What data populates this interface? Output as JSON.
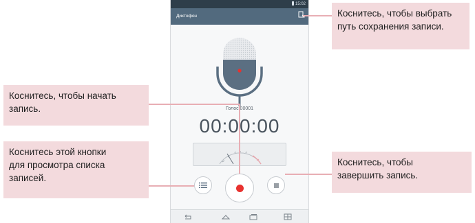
{
  "status_bar": {
    "time": "15:02"
  },
  "action_bar": {
    "title": "Диктофон"
  },
  "recorder": {
    "file_name": "Голос 00001",
    "timer": "00:00:00"
  },
  "callouts": {
    "save_path": "Коснитесь, чтобы выбрать\nпуть сохранения записи.",
    "start": "Коснитесь, чтобы начать\nзапись.",
    "list": "Коснитесь этой кнопки\nдля просмотра списка\nзаписей.",
    "stop": "Коснитесь, чтобы\nзавершить запись."
  },
  "icons": {
    "save_path": "save-path-icon",
    "microphone": "microphone-icon",
    "list": "list-icon",
    "record": "record-icon",
    "stop": "stop-icon",
    "back": "back-icon",
    "home": "home-icon",
    "recent": "recent-apps-icon",
    "dual_window": "dual-window-icon"
  },
  "colors": {
    "accent_red": "#e8322f",
    "callout_bg": "#f3dadd",
    "action_bar": "#526a7e",
    "status_bar": "#2e3e4a"
  }
}
